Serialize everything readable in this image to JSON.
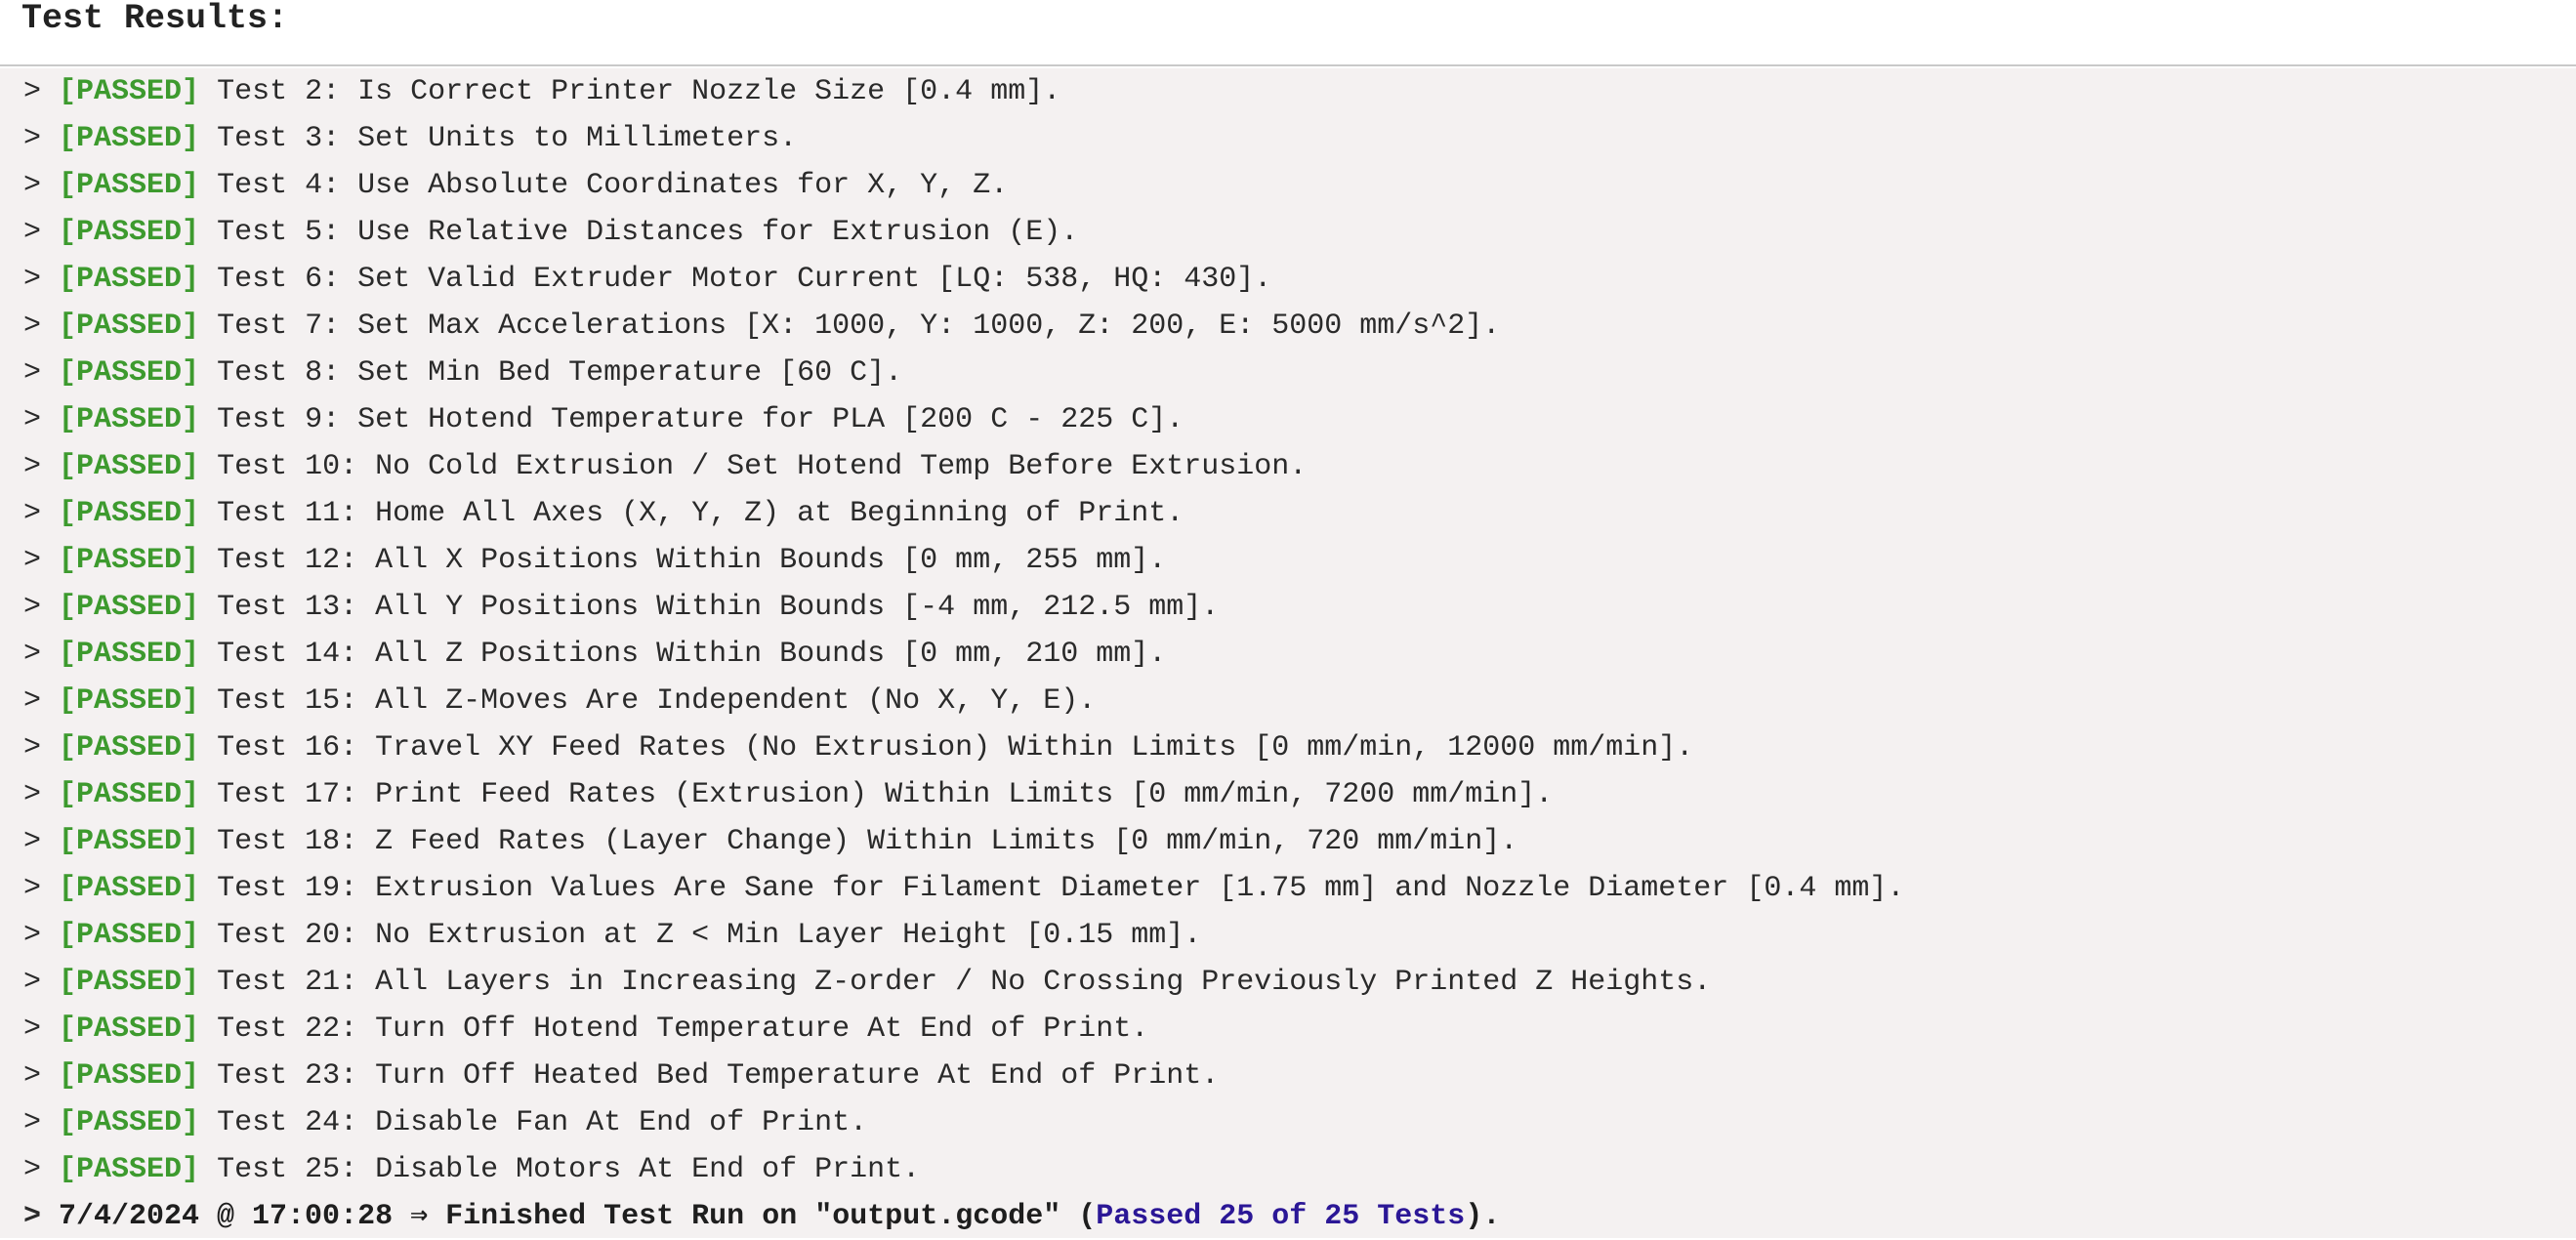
{
  "header": {
    "title": "Test Results:"
  },
  "log": {
    "prompt": "> ",
    "results": [
      {
        "status": "[PASSED]",
        "text": "Test 2: Is Correct Printer Nozzle Size [0.4 mm]."
      },
      {
        "status": "[PASSED]",
        "text": "Test 3: Set Units to Millimeters."
      },
      {
        "status": "[PASSED]",
        "text": "Test 4: Use Absolute Coordinates for X, Y, Z."
      },
      {
        "status": "[PASSED]",
        "text": "Test 5: Use Relative Distances for Extrusion (E)."
      },
      {
        "status": "[PASSED]",
        "text": "Test 6: Set Valid Extruder Motor Current [LQ: 538, HQ: 430]."
      },
      {
        "status": "[PASSED]",
        "text": "Test 7: Set Max Accelerations [X: 1000, Y: 1000, Z: 200, E: 5000 mm/s^2]."
      },
      {
        "status": "[PASSED]",
        "text": "Test 8: Set Min Bed Temperature [60 C]."
      },
      {
        "status": "[PASSED]",
        "text": "Test 9: Set Hotend Temperature for PLA [200 C - 225 C]."
      },
      {
        "status": "[PASSED]",
        "text": "Test 10: No Cold Extrusion / Set Hotend Temp Before Extrusion."
      },
      {
        "status": "[PASSED]",
        "text": "Test 11: Home All Axes (X, Y, Z) at Beginning of Print."
      },
      {
        "status": "[PASSED]",
        "text": "Test 12: All X Positions Within Bounds [0 mm, 255 mm]."
      },
      {
        "status": "[PASSED]",
        "text": "Test 13: All Y Positions Within Bounds [-4 mm, 212.5 mm]."
      },
      {
        "status": "[PASSED]",
        "text": "Test 14: All Z Positions Within Bounds [0 mm, 210 mm]."
      },
      {
        "status": "[PASSED]",
        "text": "Test 15: All Z-Moves Are Independent (No X, Y, E)."
      },
      {
        "status": "[PASSED]",
        "text": "Test 16: Travel XY Feed Rates (No Extrusion) Within Limits [0 mm/min, 12000 mm/min]."
      },
      {
        "status": "[PASSED]",
        "text": "Test 17: Print Feed Rates (Extrusion) Within Limits [0 mm/min, 7200 mm/min]."
      },
      {
        "status": "[PASSED]",
        "text": "Test 18: Z Feed Rates (Layer Change) Within Limits [0 mm/min, 720 mm/min]."
      },
      {
        "status": "[PASSED]",
        "text": "Test 19: Extrusion Values Are Sane for Filament Diameter [1.75 mm] and Nozzle Diameter [0.4 mm]."
      },
      {
        "status": "[PASSED]",
        "text": "Test 20: No Extrusion at Z < Min Layer Height [0.15 mm]."
      },
      {
        "status": "[PASSED]",
        "text": "Test 21: All Layers in Increasing Z-order / No Crossing Previously Printed Z Heights."
      },
      {
        "status": "[PASSED]",
        "text": "Test 22: Turn Off Hotend Temperature At End of Print."
      },
      {
        "status": "[PASSED]",
        "text": "Test 23: Turn Off Heated Bed Temperature At End of Print."
      },
      {
        "status": "[PASSED]",
        "text": "Test 24: Disable Fan At End of Print."
      },
      {
        "status": "[PASSED]",
        "text": "Test 25: Disable Motors At End of Print."
      }
    ],
    "summary": {
      "prefix": "7/4/2024 @ 17:00:28 ⇒ Finished Test Run on \"output.gcode\" (",
      "count": "Passed 25 of 25 Tests",
      "suffix": ")."
    }
  },
  "colors": {
    "passed": "#3d9a2e",
    "summary_count": "#2b1796",
    "log_background": "#f4f1f1"
  }
}
